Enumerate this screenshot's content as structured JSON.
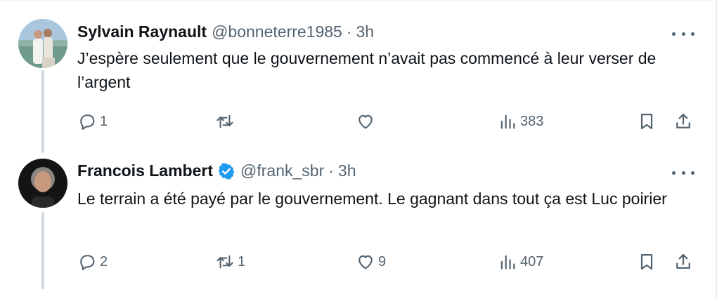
{
  "tweets": [
    {
      "author_name": "Sylvain Raynault",
      "verified": false,
      "handle": "@bonneterre1985",
      "separator": "·",
      "time": "3h",
      "text": "J’espère seulement que le gouvernement n’avait pas commencé à leur verser de l’argent",
      "reply_count": "1",
      "retweet_count": "",
      "like_count": "",
      "view_count": "383",
      "avatar": "couple-wedding-photo"
    },
    {
      "author_name": "Francois Lambert",
      "verified": true,
      "handle": "@frank_sbr",
      "separator": "·",
      "time": "3h",
      "text": "Le terrain a été payé par le gouvernement. Le gagnant dans tout ça est Luc poirier",
      "reply_count": "2",
      "retweet_count": "1",
      "like_count": "9",
      "view_count": "407",
      "avatar": "man-portrait-dark"
    }
  ],
  "colors": {
    "text": "#0f1419",
    "secondary": "#536471",
    "verified": "#1d9bf0",
    "thread_line": "#cfd9de"
  }
}
